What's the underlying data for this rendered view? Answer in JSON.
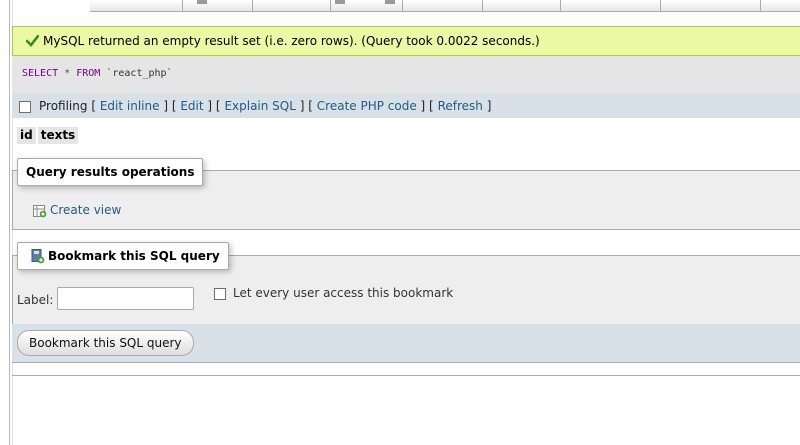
{
  "success": {
    "message": "MySQL returned an empty result set (i.e. zero rows). (Query took 0.0022 seconds.)"
  },
  "sql": {
    "select_kw": "SELECT",
    "star": "*",
    "from_kw": "FROM",
    "table": "`react_php`"
  },
  "toolbar": {
    "profiling_label": "Profiling",
    "open1": "[",
    "edit_inline": "Edit inline",
    "sep1": "] [",
    "edit": "Edit",
    "sep2": "] [",
    "explain_sql": "Explain SQL",
    "sep3": "] [",
    "create_php": "Create PHP code",
    "sep4": "] [",
    "refresh": "Refresh",
    "close": "]"
  },
  "results": {
    "columns": [
      "id",
      "texts"
    ]
  },
  "query_ops": {
    "legend": "Query results operations",
    "create_view": "Create view"
  },
  "bookmark": {
    "legend": "Bookmark this SQL query",
    "label_text": "Label:",
    "label_value": "",
    "every_user_text": "Let every user access this bookmark",
    "submit": "Bookmark this SQL query"
  },
  "icons": {
    "success": "check-icon",
    "create_view": "view-icon",
    "bookmark": "bookmark-icon"
  }
}
